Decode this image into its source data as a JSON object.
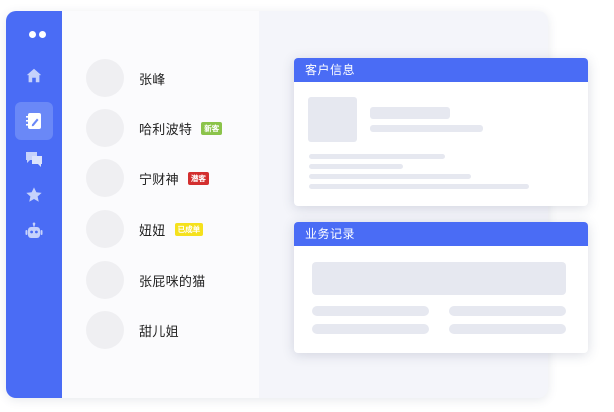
{
  "sidebar": {
    "nav": [
      {
        "icon": "home-icon",
        "active": false
      },
      {
        "icon": "notebook-icon",
        "active": true
      },
      {
        "icon": "chat-icon",
        "active": false
      },
      {
        "icon": "star-icon",
        "active": false
      },
      {
        "icon": "robot-icon",
        "active": false
      }
    ]
  },
  "contacts": [
    {
      "name": "张峰"
    },
    {
      "name": "哈利波特",
      "badge": "新客"
    },
    {
      "name": "宁财神",
      "badge": "潜客"
    },
    {
      "name": "妞妞",
      "badge": "已成单"
    },
    {
      "name": "张屁咪的猫"
    },
    {
      "name": "甜儿姐"
    }
  ],
  "colors": {
    "accent": "#4a6cf5",
    "badge_new": "#8bc34a",
    "badge_potential": "#d32f2f",
    "badge_closed": "#f5e11d"
  },
  "cards": {
    "customer_info": {
      "title": "客户信息"
    },
    "business_records": {
      "title": "业务记录"
    }
  }
}
